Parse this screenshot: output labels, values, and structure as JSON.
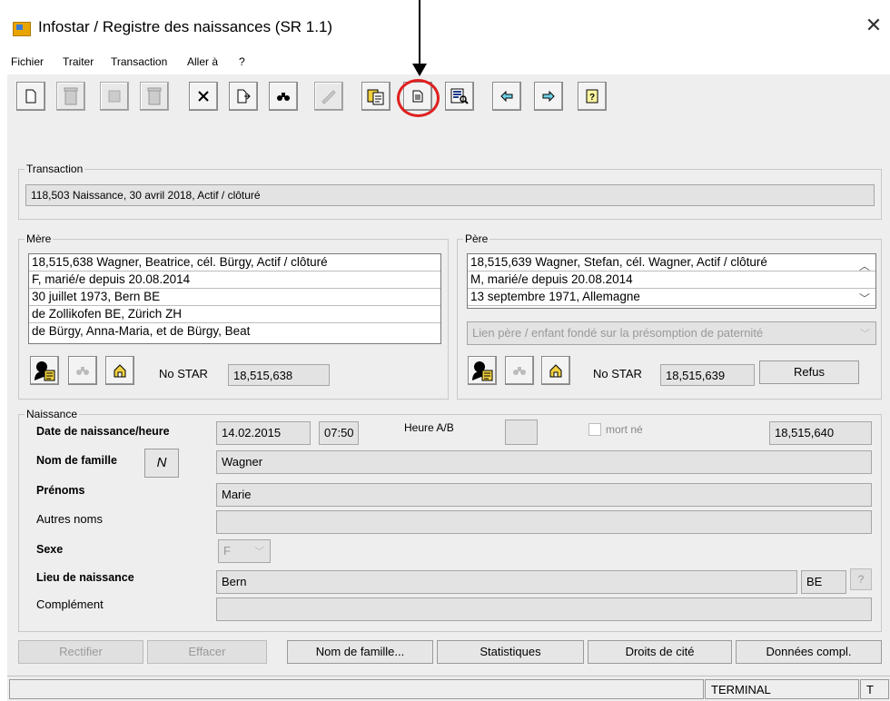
{
  "window": {
    "title": "Infostar / Registre des naissances (SR 1.1)",
    "close_glyph": "✕"
  },
  "menu": [
    "Fichier",
    "Traiter",
    "Transaction",
    "Aller à",
    "?"
  ],
  "toolbar": {
    "icons": [
      "new-document-icon",
      "trash-icon",
      "save-icon",
      "trash-icon",
      "delete-x-icon",
      "import-icon",
      "binoculars-icon",
      "sign-icon",
      "copy-icon",
      "document-icon",
      "preview-icon",
      "arrow-left-icon",
      "arrow-right-icon",
      "help-icon"
    ],
    "highlighted": "document-icon"
  },
  "transaction": {
    "label": "Transaction",
    "value": "118,503  Naissance, 30 avril 2018, Actif / clôturé"
  },
  "mere": {
    "label": "Mère",
    "lines": [
      "18,515,638  Wagner, Beatrice, cél. Bürgy, Actif / clôturé",
      "F, marié/e depuis 20.08.2014",
      "30 juillet 1973, Bern BE",
      "de Zollikofen BE, Zürich ZH",
      "de Bürgy, Anna-Maria, et de Bürgy, Beat"
    ],
    "no_star_label": "No STAR",
    "no_star": "18,515,638"
  },
  "pere": {
    "label": "Père",
    "lines": [
      "18,515,639  Wagner, Stefan, cél. Wagner, Actif / clôturé",
      "M, marié/e depuis 20.08.2014",
      "13 septembre 1971, Allemagne"
    ],
    "lien": "Lien père / enfant fondé sur la présomption de paternité",
    "no_star_label": "No STAR",
    "no_star": "18,515,639",
    "refus_label": "Refus"
  },
  "naissance": {
    "label": "Naissance",
    "date_label": "Date de naissance/heure",
    "date": "14.02.2015",
    "heure": "07:50",
    "heure_ab_label": "Heure A/B",
    "heure_ab": "",
    "mort_ne_label": "mort né",
    "id": "18,515,640",
    "nom_label": "Nom de famille",
    "nom_btn": "N",
    "nom": "Wagner",
    "prenoms_label": "Prénoms",
    "prenoms": "Marie",
    "autres_label": "Autres noms",
    "autres": "",
    "sexe_label": "Sexe",
    "sexe": "F",
    "lieu_label": "Lieu de naissance",
    "lieu": "Bern",
    "canton": "BE",
    "lieu_help": "?",
    "complement_label": "Complément",
    "complement": ""
  },
  "buttons": {
    "rectifier": "Rectifier",
    "effacer": "Effacer",
    "nom_famille": "Nom de famille...",
    "statistiques": "Statistiques",
    "droits": "Droits de cité",
    "donnees": "Données compl."
  },
  "status": {
    "cell1": "",
    "terminal": "TERMINAL",
    "t": "T"
  },
  "colors": {
    "annotation_circle": "#e02020",
    "window_bg": "#eeeeee"
  }
}
